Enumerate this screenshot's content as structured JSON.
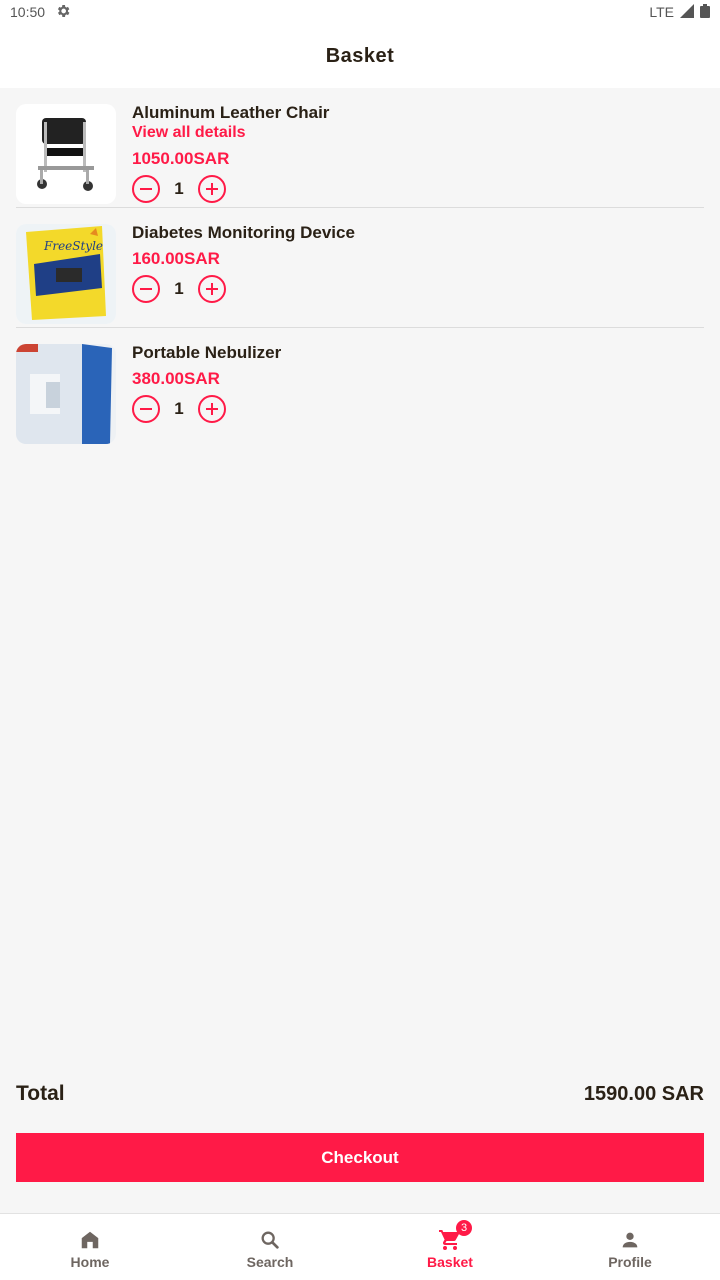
{
  "status_bar": {
    "time": "10:50",
    "network": "LTE"
  },
  "header": {
    "title": "Basket"
  },
  "items": [
    {
      "name": "Aluminum Leather Chair",
      "details_link": "View all details",
      "price": "1050.00SAR",
      "quantity": "1"
    },
    {
      "name": "Diabetes Monitoring Device",
      "price": "160.00SAR",
      "quantity": "1"
    },
    {
      "name": "Portable Nebulizer",
      "price": "380.00SAR",
      "quantity": "1"
    }
  ],
  "summary": {
    "total_label": "Total",
    "total_value": "1590.00 SAR"
  },
  "checkout": {
    "label": "Checkout"
  },
  "nav": {
    "items": [
      {
        "label": "Home",
        "icon": "home-icon"
      },
      {
        "label": "Search",
        "icon": "search-icon"
      },
      {
        "label": "Basket",
        "icon": "cart-icon",
        "badge": "3"
      },
      {
        "label": "Profile",
        "icon": "person-icon"
      }
    ],
    "active": "Basket"
  },
  "colors": {
    "accent": "#ff1a47",
    "text": "#2a2116",
    "background": "#f6f6f6"
  }
}
